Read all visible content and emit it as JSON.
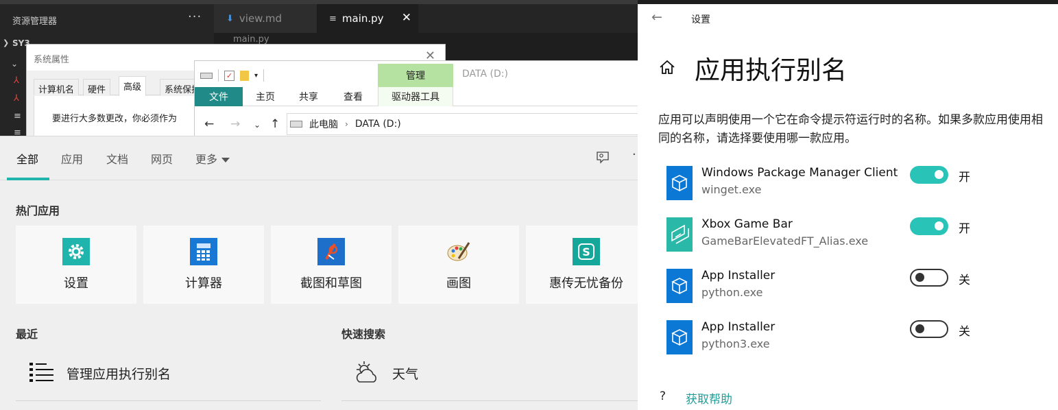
{
  "vscode": {
    "explorer_title": "资源管理器",
    "more_glyph": "···",
    "folder_name": "SY3",
    "tabs": [
      {
        "label": "view.md",
        "icon": "markdown-icon"
      },
      {
        "label": "main.py",
        "icon": "python-file-icon",
        "close": "✕"
      }
    ],
    "breadcrumb": "main.py"
  },
  "sysprops": {
    "title": "系统属性",
    "close": "✕",
    "tabs": [
      "计算机名",
      "硬件",
      "高级",
      "系统保护"
    ],
    "active_tab": "高级",
    "message": "要进行大多数更改，你必须作为"
  },
  "file_explorer": {
    "manage_label": "管理",
    "window_title": "DATA (D:)",
    "ribbon_tabs": [
      "文件",
      "主页",
      "共享",
      "查看",
      "驱动器工具"
    ],
    "address": [
      "此电脑",
      "DATA (D:)"
    ],
    "accent": "#1f8a87",
    "manage_color": "#b6e2a1"
  },
  "start_panel": {
    "tabs": [
      "全部",
      "应用",
      "文档",
      "网页",
      "更多"
    ],
    "active_tab": "全部",
    "hot_apps_title": "热门应用",
    "hot_apps": [
      {
        "label": "设置",
        "icon": "settings-gear-icon"
      },
      {
        "label": "计算器",
        "icon": "calculator-icon"
      },
      {
        "label": "截图和草图",
        "icon": "snip-sketch-icon"
      },
      {
        "label": "画图",
        "icon": "paint-palette-icon"
      },
      {
        "label": "惠传无忧备份",
        "icon": "backup-app-icon"
      }
    ],
    "recent_title": "最近",
    "recent_item": "管理应用执行别名",
    "quick_search_title": "快速搜索",
    "quick_search_item": "天气",
    "accent": "#1fb5ad"
  },
  "settings": {
    "window_title": "设置",
    "page_title": "应用执行别名",
    "description": "应用可以声明使用一个它在命令提示符运行时的名称。如果多款应用使用相同的名称，请选择要使用哪一款应用。",
    "aliases": [
      {
        "name": "Windows Package Manager Client",
        "exe": "winget.exe",
        "on": true,
        "state": "开"
      },
      {
        "name": "Xbox Game Bar",
        "exe": "GameBarElevatedFT_Alias.exe",
        "on": true,
        "state": "开"
      },
      {
        "name": "App Installer",
        "exe": "python.exe",
        "on": false,
        "state": "关"
      },
      {
        "name": "App Installer",
        "exe": "python3.exe",
        "on": false,
        "state": "关"
      }
    ],
    "help_link": "获取帮助",
    "toggle_on_color": "#2ac3b8",
    "app_icon_color": "#0a78d4",
    "xbox_icon_color": "#2ab8a8"
  }
}
